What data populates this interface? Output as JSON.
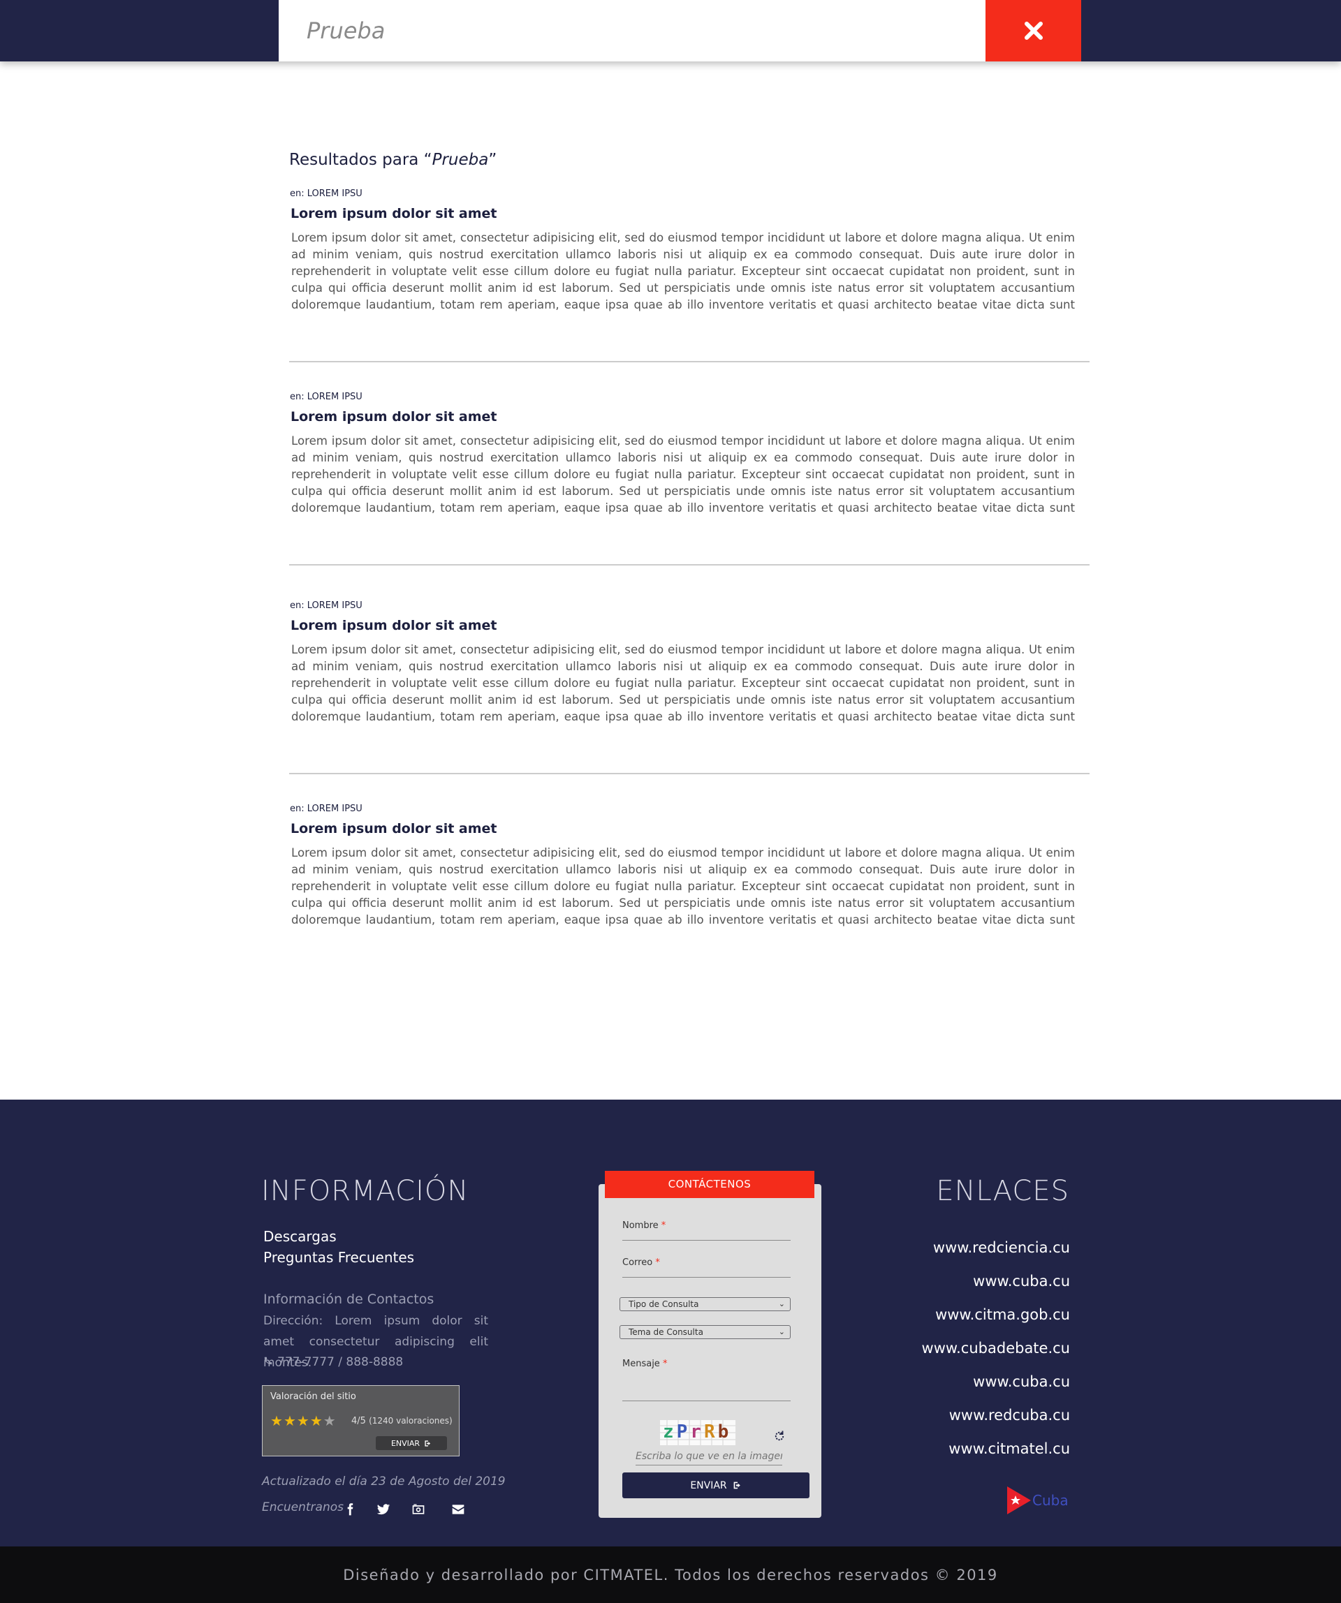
{
  "header": {
    "search_value": "Prueba",
    "close_icon": "close-icon"
  },
  "results": {
    "heading_prefix": "Resultados para “",
    "heading_query": "Prueba",
    "heading_suffix": "”",
    "items": [
      {
        "category": "en: LOREM IPSU",
        "title": "Lorem ipsum dolor sit amet",
        "text": "Lorem ipsum dolor sit amet, consectetur adipisicing elit, sed do eiusmod tempor incididunt ut labore et dolore magna aliqua. Ut enim ad minim veniam, quis nostrud exercitation ullamco laboris nisi ut aliquip ex ea commodo consequat. Duis aute irure dolor in reprehenderit in voluptate velit esse cillum dolore eu fugiat nulla pariatur. Excepteur sint occaecat cupidatat non proident, sunt in culpa qui officia deserunt mollit anim id est laborum. Sed ut perspiciatis unde omnis iste natus error sit voluptatem accusantium doloremque laudantium, totam rem aperiam, eaque ipsa quae ab illo inventore veritatis et quasi architecto beatae vitae dicta sunt explicabo. Nemo enim ipsam voluptatem quia voluptas sit aspernatur aut odit aut fugit, sed quia consequuntur magni dolores eos qui ratione"
      },
      {
        "category": "en: LOREM IPSU",
        "title": "Lorem ipsum dolor sit amet",
        "text": "Lorem ipsum dolor sit amet, consectetur adipisicing elit, sed do eiusmod tempor incididunt ut labore et dolore magna aliqua. Ut enim ad minim veniam, quis nostrud exercitation ullamco laboris nisi ut aliquip ex ea commodo consequat. Duis aute irure dolor in reprehenderit in voluptate velit esse cillum dolore eu fugiat nulla pariatur. Excepteur sint occaecat cupidatat non proident, sunt in culpa qui officia deserunt mollit anim id est laborum. Sed ut perspiciatis unde omnis iste natus error sit voluptatem accusantium doloremque laudantium, totam rem aperiam, eaque ipsa quae ab illo inventore veritatis et quasi architecto beatae vitae dicta sunt explicabo. Nemo enim ipsam voluptatem quia voluptas sit aspernatur aut odit aut fugit, sed quia consequuntur magni dolores eos qui ratione"
      },
      {
        "category": "en: LOREM IPSU",
        "title": "Lorem ipsum dolor sit amet",
        "text": "Lorem ipsum dolor sit amet, consectetur adipisicing elit, sed do eiusmod tempor incididunt ut labore et dolore magna aliqua. Ut enim ad minim veniam, quis nostrud exercitation ullamco laboris nisi ut aliquip ex ea commodo consequat. Duis aute irure dolor in reprehenderit in voluptate velit esse cillum dolore eu fugiat nulla pariatur. Excepteur sint occaecat cupidatat non proident, sunt in culpa qui officia deserunt mollit anim id est laborum. Sed ut perspiciatis unde omnis iste natus error sit voluptatem accusantium doloremque laudantium, totam rem aperiam, eaque ipsa quae ab illo inventore veritatis et quasi architecto beatae vitae dicta sunt explicabo. Nemo enim ipsam voluptatem quia voluptas sit aspernatur aut odit aut fugit, sed quia consequuntur magni dolores eos qui ratione"
      },
      {
        "category": "en: LOREM IPSU",
        "title": "Lorem ipsum dolor sit amet",
        "text": "Lorem ipsum dolor sit amet, consectetur adipisicing elit, sed do eiusmod tempor incididunt ut labore et dolore magna aliqua. Ut enim ad minim veniam, quis nostrud exercitation ullamco laboris nisi ut aliquip ex ea commodo consequat. Duis aute irure dolor in reprehenderit in voluptate velit esse cillum dolore eu fugiat nulla pariatur. Excepteur sint occaecat cupidatat non proident, sunt in culpa qui officia deserunt mollit anim id est laborum. Sed ut perspiciatis unde omnis iste natus error sit voluptatem accusantium doloremque laudantium, totam rem aperiam, eaque ipsa quae ab illo inventore veritatis et quasi architecto beatae vitae dicta sunt explicabo. Nemo enim ipsam voluptatem quia voluptas sit aspernatur aut odit aut fugit, sed quia consequuntur magni dolores eos qui ratione"
      }
    ]
  },
  "footer": {
    "info": {
      "heading": "INFORMACIÓN",
      "links": [
        "Descargas",
        "Preguntas Frecuentes"
      ],
      "contact_title": "Información de Contactos",
      "address": "Dirección: Lorem ipsum dolor sit amet consectetur adipiscing elit montes.",
      "phone": "777-7777 / 888-8888"
    },
    "rating": {
      "title": "Valoración del sitio",
      "stars_filled": 4,
      "stars_total": 5,
      "score": "4/5",
      "count": "(1240 valoraciones)",
      "send_label": "ENVIAR"
    },
    "updated": "Actualizado el día 23 de Agosto del 2019",
    "find_us": "Encuentranos",
    "social_icons": [
      "facebook-icon",
      "twitter-icon",
      "camera-icon",
      "envelope-icon"
    ],
    "form": {
      "tab_label": "CONTÁCTENOS",
      "name_label": "Nombre",
      "email_label": "Correo",
      "required_mark": "*",
      "type_select": "Tipo de Consulta",
      "topic_select": "Tema de Consulta",
      "message_label": "Mensaje",
      "captcha_text": "zPrRb",
      "captcha_placeholder": "Escriba lo que ve en la imagen",
      "send_label": "ENVIAR"
    },
    "links": {
      "heading": "ENLACES",
      "items": [
        "www.redciencia.cu",
        "www.cuba.cu",
        "www.citma.gob.cu",
        "www.cubadebate.cu",
        "www.cuba.cu",
        "www.redcuba.cu",
        "www.citmatel.cu"
      ],
      "logo_text": "Cuba"
    },
    "copyright": "Diseñado y desarrollado por CITMATEL. Todos los derechos reservados © 2019"
  },
  "colors": {
    "navy": "#212447",
    "accent_red": "#f42c1b",
    "star_gold": "#f0b90f"
  }
}
